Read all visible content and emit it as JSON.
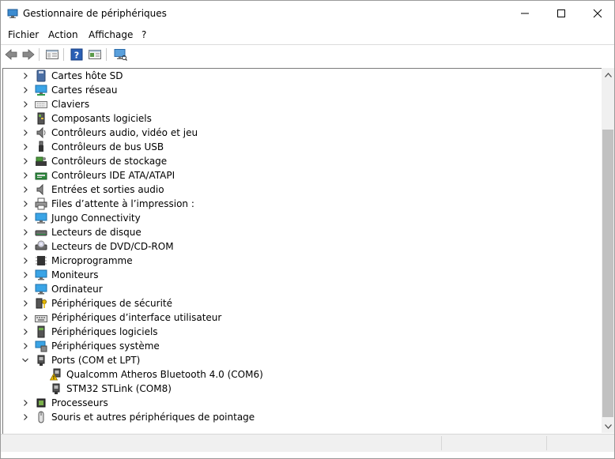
{
  "window": {
    "title": "Gestionnaire de périphériques",
    "controls": [
      "minimize-icon",
      "maximize-icon",
      "close-icon"
    ]
  },
  "menu": [
    "Fichier",
    "Action",
    "Affichage",
    "?"
  ],
  "toolbar": {
    "buttons": [
      "back-arrow-icon",
      "forward-arrow-icon",
      "properties-icon",
      "help-icon",
      "update-driver-icon",
      "scan-hardware-icon"
    ]
  },
  "tree": {
    "items": [
      {
        "label": "Cartes hôte SD",
        "icon": "sd-card-icon",
        "expanded": false
      },
      {
        "label": "Cartes réseau",
        "icon": "network-adapter-icon",
        "expanded": false
      },
      {
        "label": "Claviers",
        "icon": "keyboard-icon",
        "expanded": false
      },
      {
        "label": "Composants logiciels",
        "icon": "software-component-icon",
        "expanded": false
      },
      {
        "label": "Contrôleurs audio, vidéo et jeu",
        "icon": "speaker-icon",
        "expanded": false
      },
      {
        "label": "Contrôleurs de bus USB",
        "icon": "usb-icon",
        "expanded": false
      },
      {
        "label": "Contrôleurs de stockage",
        "icon": "storage-controller-icon",
        "expanded": false
      },
      {
        "label": "Contrôleurs IDE ATA/ATAPI",
        "icon": "ide-controller-icon",
        "expanded": false
      },
      {
        "label": "Entrées et sorties audio",
        "icon": "audio-io-icon",
        "expanded": false
      },
      {
        "label": "Files d’attente à l’impression :",
        "icon": "printer-icon",
        "expanded": false
      },
      {
        "label": "Jungo Connectivity",
        "icon": "monitor-network-icon",
        "expanded": false
      },
      {
        "label": "Lecteurs de disque",
        "icon": "disk-drive-icon",
        "expanded": false
      },
      {
        "label": "Lecteurs de DVD/CD-ROM",
        "icon": "dvd-drive-icon",
        "expanded": false
      },
      {
        "label": "Microprogramme",
        "icon": "firmware-chip-icon",
        "expanded": false
      },
      {
        "label": "Moniteurs",
        "icon": "monitor-icon",
        "expanded": false
      },
      {
        "label": "Ordinateur",
        "icon": "computer-icon",
        "expanded": false
      },
      {
        "label": "Périphériques de sécurité",
        "icon": "security-key-icon",
        "expanded": false
      },
      {
        "label": "Périphériques d’interface utilisateur",
        "icon": "hid-icon",
        "expanded": false
      },
      {
        "label": "Périphériques logiciels",
        "icon": "software-device-icon",
        "expanded": false
      },
      {
        "label": "Périphériques système",
        "icon": "system-device-icon",
        "expanded": false
      },
      {
        "label": "Ports (COM et LPT)",
        "icon": "port-icon",
        "expanded": true,
        "children": [
          {
            "label": "Qualcomm Atheros Bluetooth 4.0 (COM6)",
            "icon": "warning-port-icon",
            "warning": true
          },
          {
            "label": "STM32 STLink (COM8)",
            "icon": "port-icon",
            "warning": false
          }
        ]
      },
      {
        "label": "Processeurs",
        "icon": "processor-icon",
        "expanded": false
      },
      {
        "label": "Souris et autres périphériques de pointage",
        "icon": "mouse-icon",
        "expanded": false
      }
    ]
  },
  "colors": {
    "accent_blue": "#1e73be",
    "warning_yellow": "#f5c400"
  }
}
